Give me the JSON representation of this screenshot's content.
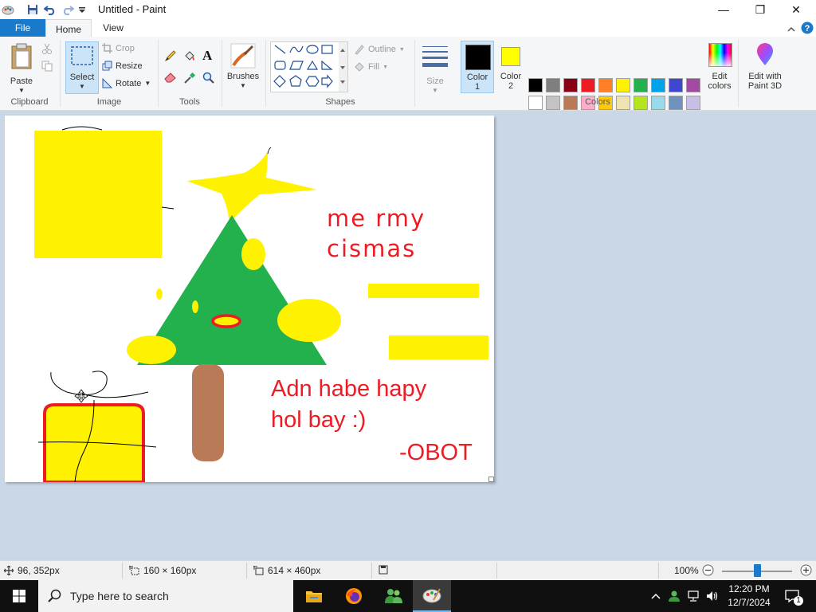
{
  "window": {
    "title": "Untitled - Paint",
    "controls": {
      "minimize": "—",
      "maximize": "❐",
      "close": "✕"
    }
  },
  "tabs": {
    "file": "File",
    "home": "Home",
    "view": "View"
  },
  "ribbon": {
    "clipboard": {
      "paste": "Paste",
      "group": "Clipboard"
    },
    "image": {
      "select": "Select",
      "crop": "Crop",
      "resize": "Resize",
      "rotate": "Rotate",
      "group": "Image"
    },
    "tools": {
      "group": "Tools"
    },
    "brushes": {
      "label": "Brushes"
    },
    "shapes": {
      "outline": "Outline",
      "fill": "Fill",
      "group": "Shapes"
    },
    "size": {
      "label": "Size"
    },
    "color1": {
      "line1": "Color",
      "line2": "1",
      "value": "#000000"
    },
    "color2": {
      "line1": "Color",
      "line2": "2",
      "value": "#ffff00"
    },
    "colors": {
      "group": "Colors",
      "row1": [
        "#000000",
        "#7f7f7f",
        "#880015",
        "#ed1c24",
        "#ff7f27",
        "#fff200",
        "#22b14c",
        "#00a2e8",
        "#3f48cc",
        "#a349a4"
      ],
      "row2": [
        "#ffffff",
        "#c3c3c3",
        "#b97a57",
        "#ffaec9",
        "#ffc90e",
        "#efe4b0",
        "#b5e61d",
        "#99d9ea",
        "#7092be",
        "#c8bfe7"
      ]
    },
    "edit_colors": {
      "line1": "Edit",
      "line2": "colors"
    },
    "paint3d": {
      "line1": "Edit with",
      "line2": "Paint 3D"
    }
  },
  "canvas_text": {
    "line1": "me rmy",
    "line2": "cismas",
    "line3": "Adn habe hapy",
    "line4": "hol bay :)",
    "signature": "-OBOT",
    "text_color": "#ed1c24"
  },
  "status": {
    "cursor_pos": "96, 352px",
    "selection_size": "160 × 160px",
    "image_size": "614 × 460px",
    "zoom": "100%"
  },
  "taskbar": {
    "search_placeholder": "Type here to search",
    "time": "12:20 PM",
    "date": "12/7/2024",
    "notification_count": "1"
  }
}
